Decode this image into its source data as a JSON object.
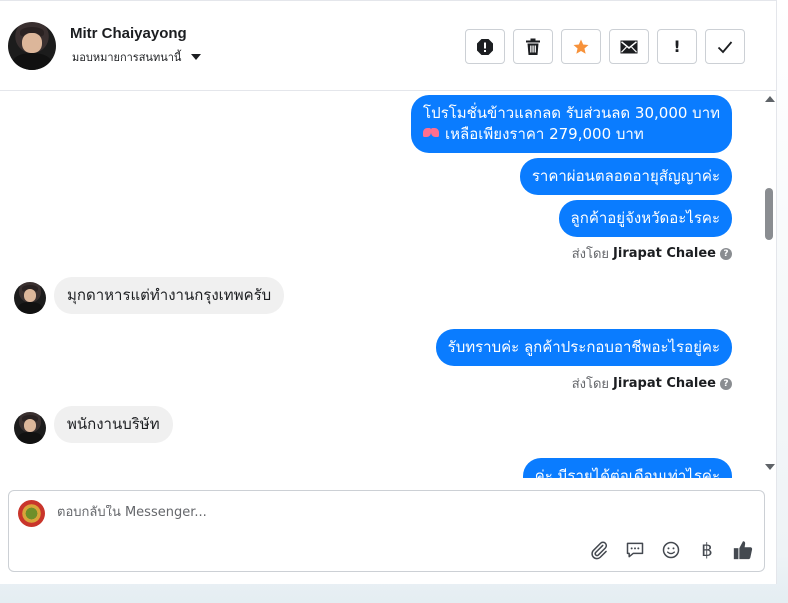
{
  "header": {
    "contact_name": "Mitr Chaiyayong",
    "assign_label": "มอบหมายการสนทนานี้"
  },
  "toolbar": {
    "buttons": [
      {
        "icon": "alert-octagon-icon"
      },
      {
        "icon": "trash-icon"
      },
      {
        "icon": "star-icon",
        "color": "#f7923a"
      },
      {
        "icon": "envelope-icon"
      },
      {
        "icon": "exclamation-icon",
        "label": "!"
      },
      {
        "icon": "checkmark-icon"
      }
    ]
  },
  "messages": {
    "out_1_line1": "โปรโมชั่นข้าวแลกลด รับส่วนลด 30,000 บาท",
    "out_1_line2": "เหลือเพียงราคา 279,000 บาท",
    "out_2": "ราคาผ่อนตลอดอายุสัญญาค่ะ",
    "out_3": "ลูกค้าอยู่จังหวัดอะไรคะ",
    "in_1": "มุกดาหารแต่ทำงานกรุงเทพครับ",
    "out_4": "รับทราบค่ะ ลูกค้าประกอบอาชีพอะไรอยู่คะ",
    "in_2": "พนักงานบริษัท",
    "out_5": "ค่ะ มีรายได้ต่อเดือนเท่าไรค่ะ",
    "sent_by_prefix": "ส่งโดย",
    "sent_by_name": "Jirapat Chalee",
    "help_mark": "?"
  },
  "composer": {
    "placeholder": "ตอบกลับใน Messenger...",
    "baht_symbol": "฿"
  },
  "colors": {
    "outgoing_bubble": "#0a7cff",
    "incoming_bubble": "#f0f0f0"
  }
}
